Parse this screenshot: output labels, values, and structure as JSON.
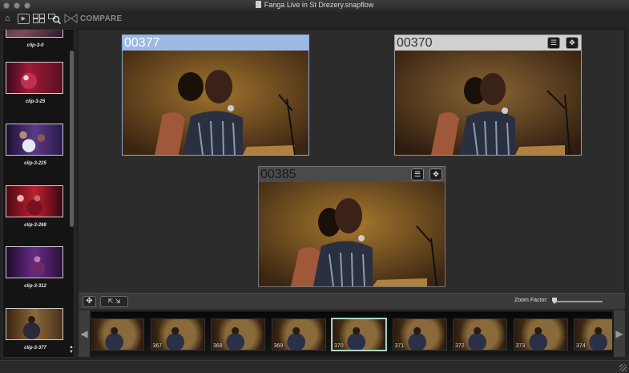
{
  "window": {
    "title": "Fanga Live in St Drezery.snapflow"
  },
  "toolbar": {
    "compare_label": "COMPARE",
    "icons": [
      "home-icon",
      "play-icon",
      "grid-icon",
      "search-zoom-icon",
      "compare-icon"
    ]
  },
  "sidebar": {
    "clips": [
      {
        "label": "clip-3-0"
      },
      {
        "label": "clip-3-25"
      },
      {
        "label": "clip-3-225"
      },
      {
        "label": "clip-3-268"
      },
      {
        "label": "clip-3-312"
      },
      {
        "label": "clip-3-377"
      }
    ]
  },
  "compare": {
    "frames": [
      {
        "number": "00377",
        "selected": true
      },
      {
        "number": "00370",
        "selected": false
      },
      {
        "number": "00385",
        "selected": false
      }
    ]
  },
  "controls": {
    "zoom_label": "Zoom Factor:",
    "zoom_value": 0.0
  },
  "filmstrip": {
    "frames": [
      "",
      "367",
      "368",
      "369",
      "370",
      "371",
      "372",
      "373",
      "374"
    ],
    "selected_index": 4
  },
  "colors": {
    "selected_header": "#9db9e6",
    "filmstrip_selected": "#bfe3d6",
    "background": "#2c2c2c"
  }
}
